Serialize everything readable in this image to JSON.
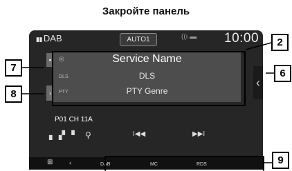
{
  "heading": "Закройте панель",
  "topbar": {
    "source": "DAB",
    "mode_button": "AUTO1",
    "clock": "10:00"
  },
  "info": {
    "service": "Service Name",
    "dls_tag": "DLS",
    "dls": "DLS",
    "pty_tag": "PTY",
    "pty": "PTY Genre"
  },
  "preset": "P01  CH 11A",
  "controls": {
    "seek_back": "I◀◀",
    "seek_forward": "▶▶I"
  },
  "functions": {
    "dab": "DAB",
    "mc": "MC",
    "rds": "RDS"
  },
  "callouts": {
    "c2": "2",
    "c6": "6",
    "c7": "7",
    "c8": "8",
    "c9": "9"
  }
}
